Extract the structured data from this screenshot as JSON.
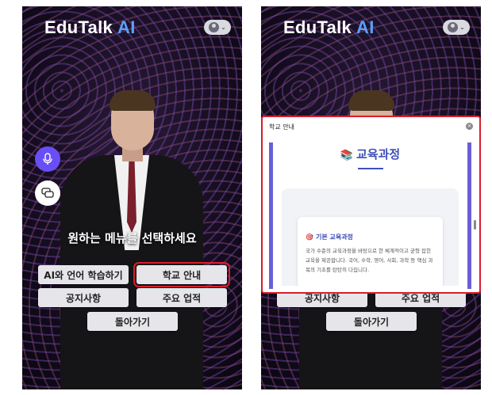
{
  "app": {
    "logo_text": "EduTalk",
    "logo_ai": "AI",
    "brand_color": "#5aa0ff",
    "accent_color": "#6a4ef5",
    "highlight_color": "#d81e2a"
  },
  "icons": {
    "profile": "avatar-icon",
    "dropdown": "chevron-down-icon",
    "mic": "microphone-icon",
    "chat": "chat-bubbles-icon",
    "close": "close-icon",
    "book": "books-icon",
    "target": "dart-icon"
  },
  "left_screen": {
    "prompt": "원하는 메뉴를 선택하세요",
    "buttons": {
      "ai_language": "AI와 언어 학습하기",
      "school_info": "학교 안내",
      "notices": "공지사항",
      "achievements": "주요 업적",
      "back": "돌아가기"
    }
  },
  "right_screen": {
    "modal": {
      "title": "학교 안내",
      "close": "×",
      "heading_icon": "📚",
      "heading": "교육과정",
      "card_title_icon": "🎯",
      "card_title": "기본 교육과정",
      "card_body": "국가 수준의 교육과정을 바탕으로 한 체계적이고 균형 잡힌 교육을 제공합니다. 국어, 수학, 영어, 사회, 과학 등 핵심 과목의 기초를 탄탄히 다집니다."
    },
    "buttons": {
      "notices": "공지사항",
      "achievements": "주요 업적",
      "back": "돌아가기"
    }
  }
}
